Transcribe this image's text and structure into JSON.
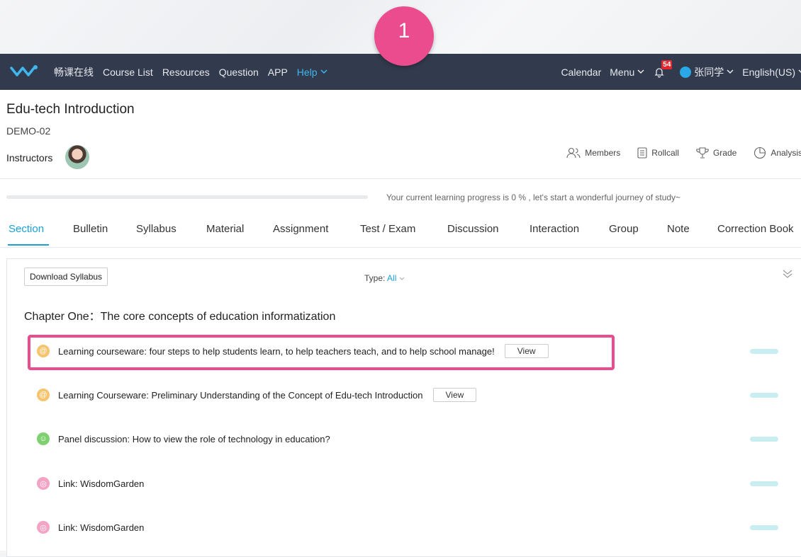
{
  "step_badge": "1",
  "nav": {
    "logo": "wisdomgarden-logo-icon",
    "left_items": [
      "畅课在线",
      "Course List",
      "Resources",
      "Question",
      "APP"
    ],
    "help": "Help",
    "calendar": "Calendar",
    "menu": "Menu",
    "notification_count": "54",
    "user": "张同学",
    "language": "English(US)"
  },
  "course": {
    "title": "Edu-tech Introduction",
    "code": "DEMO-02",
    "instructors_label": "Instructors",
    "tools": {
      "members": "Members",
      "rollcall": "Rollcall",
      "grade": "Grade",
      "analysis": "Analysis"
    }
  },
  "progress": {
    "text": "Your current learning progress is 0 % , let's start a wonderful journey of study~",
    "value_percent": 0
  },
  "tabs": [
    "Section",
    "Bulletin",
    "Syllabus",
    "Material",
    "Assignment",
    "Test / Exam",
    "Discussion",
    "Interaction",
    "Group",
    "Note",
    "Correction Book"
  ],
  "active_tab": "Section",
  "panel": {
    "download_button": "Download Syllabus",
    "type_label": "Type:",
    "type_value": "All",
    "chapter": "Chapter One：The core concepts of education informatization",
    "items": [
      {
        "kind": "courseware",
        "icon": "courseware-icon",
        "color": "#f7c46d",
        "label": "Learning courseware: four steps to help students learn, to help teachers teach, and to help school manage!",
        "button": "View",
        "highlighted": true
      },
      {
        "kind": "courseware",
        "icon": "courseware-icon",
        "color": "#f7c46d",
        "label": "Learning Courseware: Preliminary Understanding of the Concept of Edu-tech Introduction",
        "button": "View"
      },
      {
        "kind": "discussion",
        "icon": "discussion-icon",
        "color": "#7fd070",
        "label": "Panel discussion: How to view the role of technology in education?"
      },
      {
        "kind": "link",
        "icon": "link-icon",
        "color": "#f3a3c4",
        "label": "Link: WisdomGarden"
      },
      {
        "kind": "link",
        "icon": "link-icon",
        "color": "#f3a3c4",
        "label": "Link: WisdomGarden"
      }
    ]
  },
  "colors": {
    "accent": "#1ba0d9",
    "nav_bg": "#323b4e",
    "highlight": "#ea4c8d",
    "badge": "#e5262c"
  }
}
